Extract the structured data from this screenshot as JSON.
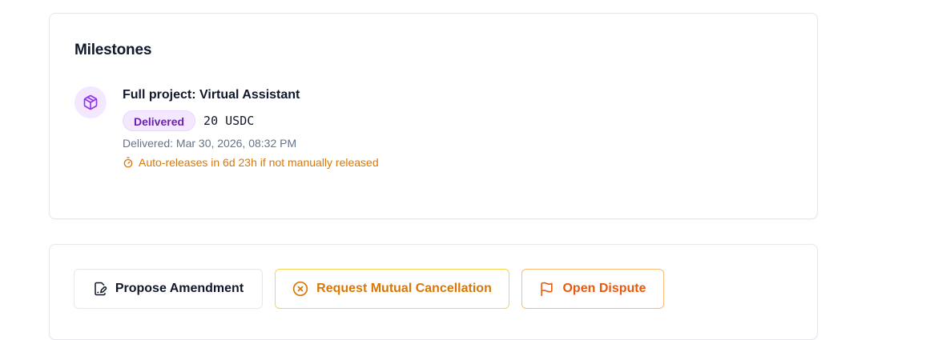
{
  "milestones": {
    "title": "Milestones",
    "items": [
      {
        "icon": "package-icon",
        "title": "Full project: Virtual Assistant",
        "status": "Delivered",
        "amount": "20 USDC",
        "delivered_at": "Delivered: Mar 30, 2026, 08:32 PM",
        "auto_release": "Auto-releases in 6d 23h if not manually released"
      }
    ]
  },
  "actions": {
    "propose_amendment": {
      "label": "Propose Amendment",
      "icon": "file-signature-icon"
    },
    "request_cancellation": {
      "label": "Request Mutual Cancellation",
      "icon": "circle-x-icon"
    },
    "open_dispute": {
      "label": "Open Dispute",
      "icon": "flag-icon"
    }
  },
  "colors": {
    "accent_purple": "#9333ea",
    "badge_bg": "#f3e8ff",
    "badge_text": "#6b21a8",
    "warning_amber": "#d97706",
    "danger_orange": "#ea580c",
    "muted_text": "#64748b"
  }
}
